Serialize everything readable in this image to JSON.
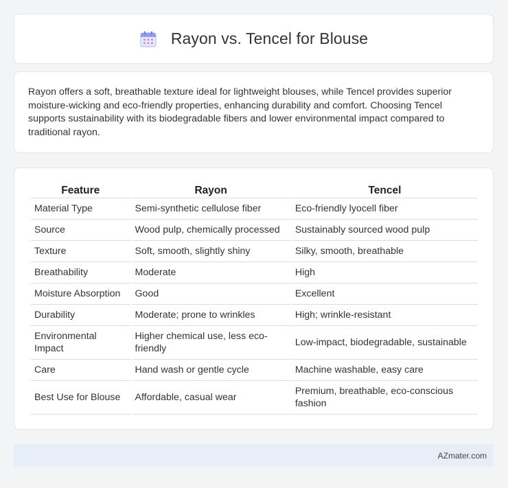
{
  "header": {
    "title": "Rayon vs. Tencel for Blouse",
    "icon": "calendar-icon"
  },
  "summary": {
    "text": "Rayon offers a soft, breathable texture ideal for lightweight blouses, while Tencel provides superior moisture-wicking and eco-friendly properties, enhancing durability and comfort. Choosing Tencel supports sustainability with its biodegradable fibers and lower environmental impact compared to traditional rayon."
  },
  "table": {
    "headers": [
      "Feature",
      "Rayon",
      "Tencel"
    ],
    "rows": [
      [
        "Material Type",
        "Semi-synthetic cellulose fiber",
        "Eco-friendly lyocell fiber"
      ],
      [
        "Source",
        "Wood pulp, chemically processed",
        "Sustainably sourced wood pulp"
      ],
      [
        "Texture",
        "Soft, smooth, slightly shiny",
        "Silky, smooth, breathable"
      ],
      [
        "Breathability",
        "Moderate",
        "High"
      ],
      [
        "Moisture Absorption",
        "Good",
        "Excellent"
      ],
      [
        "Durability",
        "Moderate; prone to wrinkles",
        "High; wrinkle-resistant"
      ],
      [
        "Environmental Impact",
        "Higher chemical use, less eco-friendly",
        "Low-impact, biodegradable, sustainable"
      ],
      [
        "Care",
        "Hand wash or gentle cycle",
        "Machine washable, easy care"
      ],
      [
        "Best Use for Blouse",
        "Affordable, casual wear",
        "Premium, breathable, eco-conscious fashion"
      ]
    ]
  },
  "footer": {
    "text": "AZmater.com"
  },
  "colors": {
    "background": "#f3f4f6",
    "card": "#ffffff",
    "footer_bg": "#e8eef7",
    "icon_accent": "#7b8cde"
  }
}
